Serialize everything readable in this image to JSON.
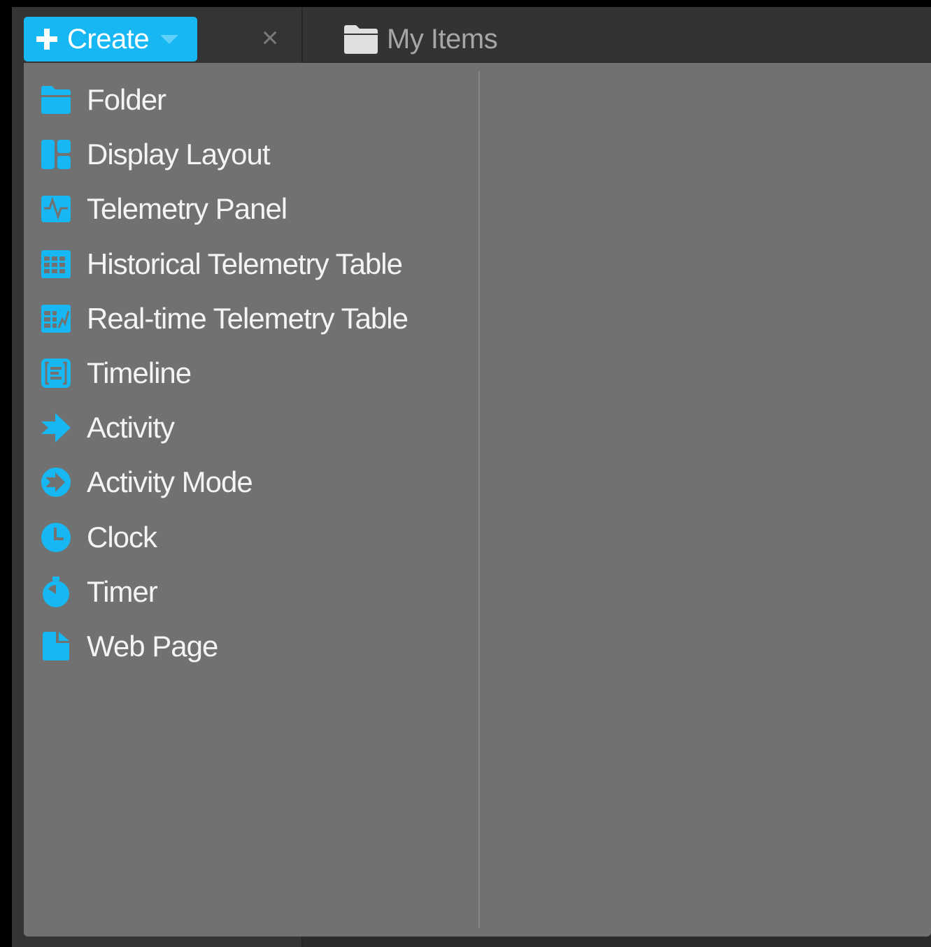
{
  "colors": {
    "accent": "#16b7f2",
    "menu_bg": "#717171",
    "header_bg": "#333333"
  },
  "create_button": {
    "label": "Create",
    "plus_icon": "plus-icon",
    "caret_icon": "caret-down-icon"
  },
  "close_icon": "×",
  "breadcrumb": {
    "icon": "folder-icon",
    "title": "My Items"
  },
  "menu": {
    "items": [
      {
        "label": "Folder",
        "icon": "folder-icon"
      },
      {
        "label": "Display Layout",
        "icon": "display-layout-icon"
      },
      {
        "label": "Telemetry Panel",
        "icon": "telemetry-panel-icon"
      },
      {
        "label": "Historical Telemetry Table",
        "icon": "historical-table-icon"
      },
      {
        "label": "Real-time Telemetry Table",
        "icon": "realtime-table-icon"
      },
      {
        "label": "Timeline",
        "icon": "timeline-icon"
      },
      {
        "label": "Activity",
        "icon": "activity-icon"
      },
      {
        "label": "Activity Mode",
        "icon": "activity-mode-icon"
      },
      {
        "label": "Clock",
        "icon": "clock-icon"
      },
      {
        "label": "Timer",
        "icon": "timer-icon"
      },
      {
        "label": "Web Page",
        "icon": "web-page-icon"
      }
    ]
  }
}
